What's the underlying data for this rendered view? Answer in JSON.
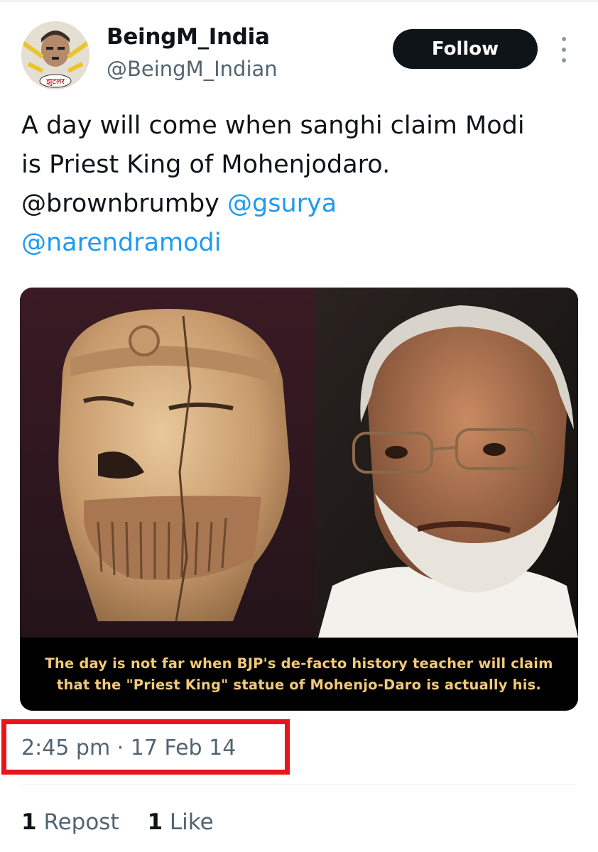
{
  "author": {
    "display_name": "BeingM_India",
    "handle": "@BeingM_Indian",
    "avatar_text": "झुटलर"
  },
  "follow_button": {
    "label": "Follow"
  },
  "tweet": {
    "line1": "A day will come when sanghi claim Modi",
    "line2": "is Priest King of Mohenjodaro.",
    "mention1": "@brownbrumby",
    "mention2": "@gsurya",
    "mention3": "@narendramodi"
  },
  "media": {
    "caption_line1": "The day is not far when BJP's de-facto history teacher will claim",
    "caption_line2": "that the \"Priest King\" statue of Mohenjo-Daro is actually his."
  },
  "timestamp": "2:45 pm · 17 Feb 14",
  "stats": {
    "repost_count": "1",
    "repost_label": "Repost",
    "like_count": "1",
    "like_label": "Like"
  },
  "colors": {
    "link": "#1d9bf0",
    "follow_bg": "#0f1419",
    "highlight_box": "#e8161b",
    "caption_text": "#f2c978"
  }
}
